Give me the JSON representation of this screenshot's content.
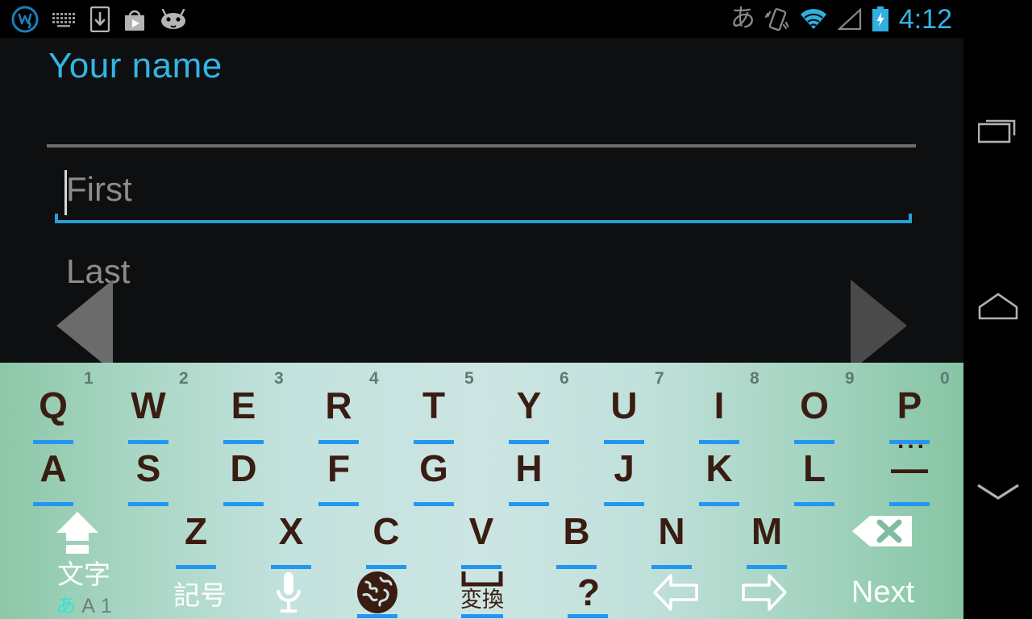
{
  "statusbar": {
    "time": "4:12",
    "ime_indicator": "あ",
    "left_icons": [
      "wordpress-icon",
      "keyboard-icon",
      "download-icon",
      "play-store-icon",
      "android-icon"
    ],
    "right_icons": [
      "vibrate-icon",
      "wifi-icon",
      "cell-signal-icon",
      "battery-charging-icon"
    ],
    "accent": "#33b5e5"
  },
  "app": {
    "title": "Your name",
    "fields": [
      {
        "name": "first",
        "placeholder": "First",
        "value": "",
        "focused": true
      },
      {
        "name": "last",
        "placeholder": "Last",
        "value": "",
        "focused": false
      }
    ],
    "prev_label": "prev-arrow",
    "next_label": "next-arrow"
  },
  "keyboard": {
    "row1": [
      {
        "char": "Q",
        "hint": "1"
      },
      {
        "char": "W",
        "hint": "2"
      },
      {
        "char": "E",
        "hint": "3"
      },
      {
        "char": "R",
        "hint": "4"
      },
      {
        "char": "T",
        "hint": "5"
      },
      {
        "char": "Y",
        "hint": "6"
      },
      {
        "char": "U",
        "hint": "7"
      },
      {
        "char": "I",
        "hint": "8"
      },
      {
        "char": "O",
        "hint": "9"
      },
      {
        "char": "P",
        "hint": "0"
      }
    ],
    "row2": [
      {
        "char": "A"
      },
      {
        "char": "S"
      },
      {
        "char": "D"
      },
      {
        "char": "F"
      },
      {
        "char": "G"
      },
      {
        "char": "H"
      },
      {
        "char": "J"
      },
      {
        "char": "K"
      },
      {
        "char": "L"
      },
      {
        "char": "—",
        "hint": "..."
      }
    ],
    "row3": [
      {
        "char": "Z"
      },
      {
        "char": "X"
      },
      {
        "char": "C"
      },
      {
        "char": "V"
      },
      {
        "char": "B"
      },
      {
        "char": "N"
      },
      {
        "char": "M"
      }
    ],
    "shift_icon": "shift-icon",
    "backspace_icon": "backspace-icon",
    "row4": {
      "mode_label": "文字",
      "mode_kana": "あ",
      "mode_alpha": "A",
      "mode_num": "1",
      "symbol_label": "記号",
      "mic_icon": "microphone-icon",
      "globe_icon": "globe-icon",
      "space_label": "変換",
      "question_label": "?",
      "left_arrow_icon": "arrow-left-icon",
      "right_arrow_icon": "arrow-right-icon",
      "enter_label": "Next"
    }
  },
  "navbar": {
    "recents": "recents-icon",
    "home": "home-icon",
    "hide_keyboard": "hide-keyboard-icon"
  }
}
